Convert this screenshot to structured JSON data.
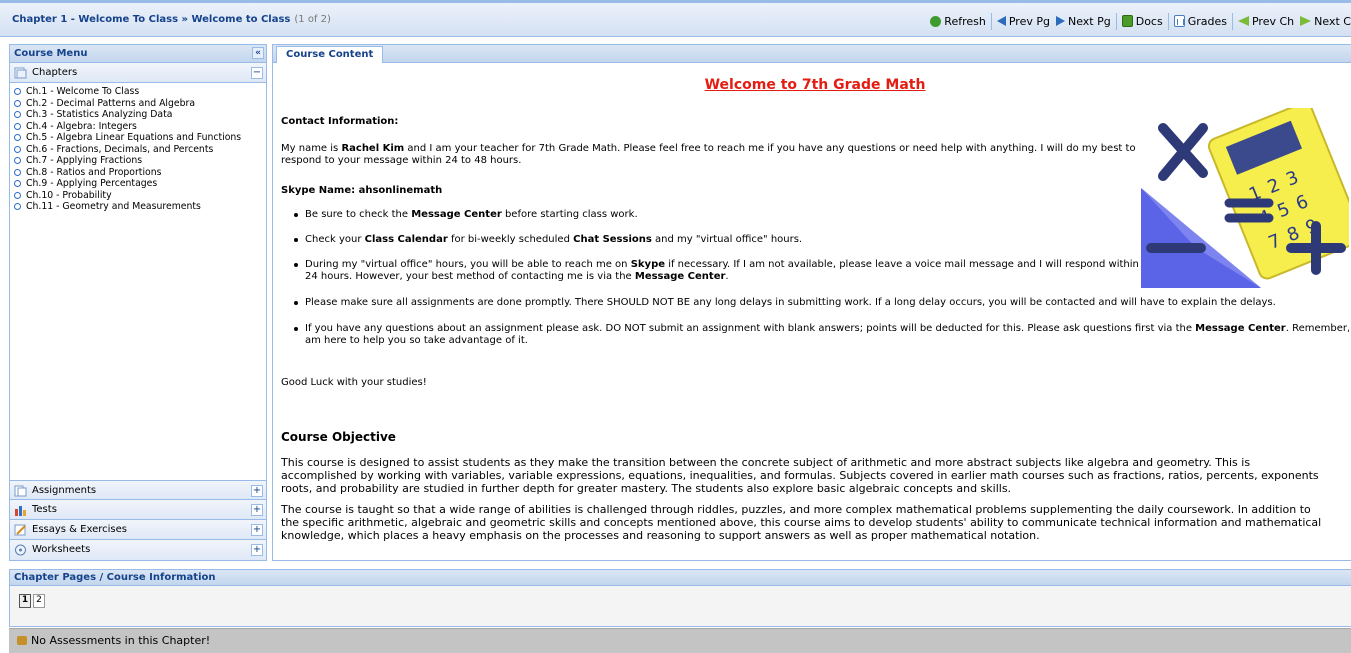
{
  "header": {
    "chapter_title": "Chapter 1 - Welcome To Class » Welcome to Class",
    "page_info": "(1 of 2)",
    "toolbar": {
      "refresh": "Refresh",
      "prev_page": "Prev Pg",
      "next_page": "Next Pg",
      "docs": "Docs",
      "grades": "Grades",
      "prev_chapter": "Prev Ch",
      "next_chapter": "Next Cl"
    }
  },
  "sidebar": {
    "title": "Course Menu",
    "chapters_label": "Chapters",
    "chapters": [
      "Ch.1 - Welcome To Class",
      "Ch.2 - Decimal Patterns and Algebra",
      "Ch.3 - Statistics Analyzing Data",
      "Ch.4 - Algebra: Integers",
      "Ch.5 - Algebra Linear Equations and Functions",
      "Ch.6 - Fractions, Decimals, and Percents",
      "Ch.7 - Applying Fractions",
      "Ch.8 - Ratios and Proportions",
      "Ch.9 - Applying Percentages",
      "Ch.10 - Probability",
      "Ch.11 - Geometry and Measurements"
    ],
    "sections": [
      "Assignments",
      "Tests",
      "Essays & Exercises",
      "Worksheets"
    ]
  },
  "content": {
    "tab": "Course Content",
    "title": "Welcome to 7th Grade Math",
    "contact_heading": "Contact Information:",
    "intro_pre": "My name is ",
    "teacher_name": "Rachel Kim",
    "intro_post": " and I am your teacher for 7th Grade Math. Please feel free to reach me if you have any questions or need help with anything.  I will do my best to",
    "intro_line2": "respond to your message within 24 to 48 hours.",
    "skype_label": "Skype Name:  ahsonlinemath",
    "bullets": {
      "b1_pre": "Be sure to check the ",
      "b1_bold": "Message Center",
      "b1_post": " before starting class work.",
      "b2_pre": "Check your ",
      "b2_bold1": "Class Calendar",
      "b2_mid": " for bi-weekly scheduled ",
      "b2_bold2": "Chat Sessions",
      "b2_post": " and my \"virtual office\" hours.",
      "b3_pre": "During my \"virtual office\" hours, you will be able to reach me on ",
      "b3_bold": "Skype",
      "b3_post": " if necessary.  If I am not available, please leave a voice mail message and I will respond within",
      "b3_line2_pre": "24 hours.  However, your best method of contacting me is via the ",
      "b3_line2_bold": "Message Center",
      "b3_line2_post": ".",
      "b4": "Please make sure all assignments are done promptly.  There SHOULD NOT BE any long delays in submitting work.  If a long delay occurs, you will be contacted and will have to explain the delays.",
      "b5_pre": "If you have any questions about an assignment please ask.  DO NOT submit an assignment with blank answers; points will be deducted for this.  Please ask questions first via the ",
      "b5_bold": "Message Center",
      "b5_post": ".  Remember,",
      "b5_line2": "am here to help you so take advantage of it."
    },
    "good_luck": "Good Luck with your studies!",
    "objective_heading": "Course Objective",
    "objective_p1": [
      "This course is designed to assist students as they make the transition between the concrete subject of arithmetic and more abstract subjects like algebra and geometry. This is",
      "accomplished by working with variables, variable expressions, equations, inequalities, and formulas. Subjects covered in earlier math courses such as fractions, ratios, percents, exponents",
      "roots, and probability are studied in further depth for greater mastery. The students also explore basic algebraic concepts and skills."
    ],
    "objective_p2": [
      "The course is taught so that a wide range of abilities is challenged through riddles, puzzles, and more complex mathematical problems supplementing the daily coursework. In addition to",
      "the specific arithmetic, algebraic and geometric skills and concepts mentioned above, this course aims to develop students' ability to communicate technical information and mathematical",
      "knowledge, which places a heavy emphasis on the processes and reasoning to support answers as well as proper mathematical notation."
    ],
    "calc_keys": [
      "1",
      "2",
      "3",
      "4",
      "5",
      "6",
      "7",
      "8",
      "9"
    ]
  },
  "bottom": {
    "title": "Chapter Pages / Course Information",
    "pages": [
      "1",
      "2"
    ],
    "status": "No Assessments in this Chapter!"
  },
  "colors": {
    "accent": "#15428b",
    "border": "#99bbe8",
    "title_red": "#e41c12"
  }
}
